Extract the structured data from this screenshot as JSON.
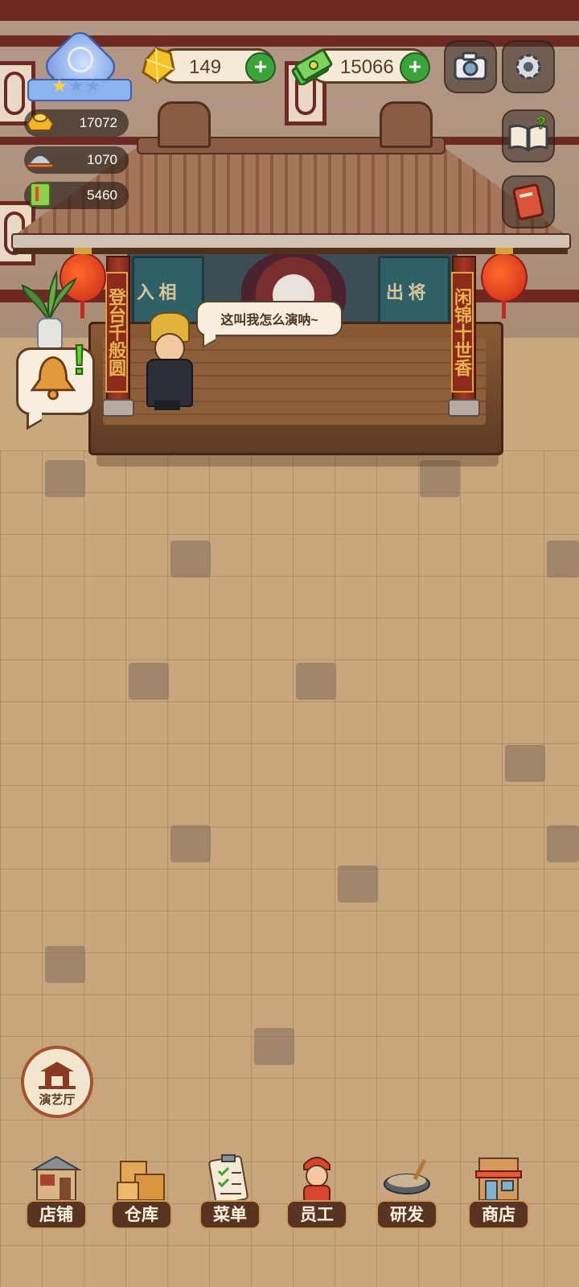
{
  "hud": {
    "rank": {
      "stars_filled": 1,
      "stars_total": 3
    },
    "resources": [
      {
        "id": "gold-ingot",
        "value": "17072"
      },
      {
        "id": "dish-cloche",
        "value": "1070"
      },
      {
        "id": "recipe-book",
        "value": "5460"
      }
    ],
    "gems": {
      "value": "149"
    },
    "cash": {
      "value": "15066"
    }
  },
  "stage": {
    "speech": "这叫我怎么演呐~",
    "curtain_left": "入 相",
    "curtain_right": "出 将",
    "couplet_left": "登台千般圆",
    "couplet_right": "闲锦十世香"
  },
  "side": {
    "opera_hall_label": "演艺厅"
  },
  "nav": [
    {
      "id": "shop-front",
      "label": "店铺"
    },
    {
      "id": "warehouse",
      "label": "仓库"
    },
    {
      "id": "menu",
      "label": "菜单"
    },
    {
      "id": "staff",
      "label": "员工"
    },
    {
      "id": "research",
      "label": "研发"
    },
    {
      "id": "store",
      "label": "商店"
    }
  ],
  "colors": {
    "accent_green": "#3aa33a",
    "nav_bg": "#5a3422",
    "pillar_red": "#a53a24"
  }
}
